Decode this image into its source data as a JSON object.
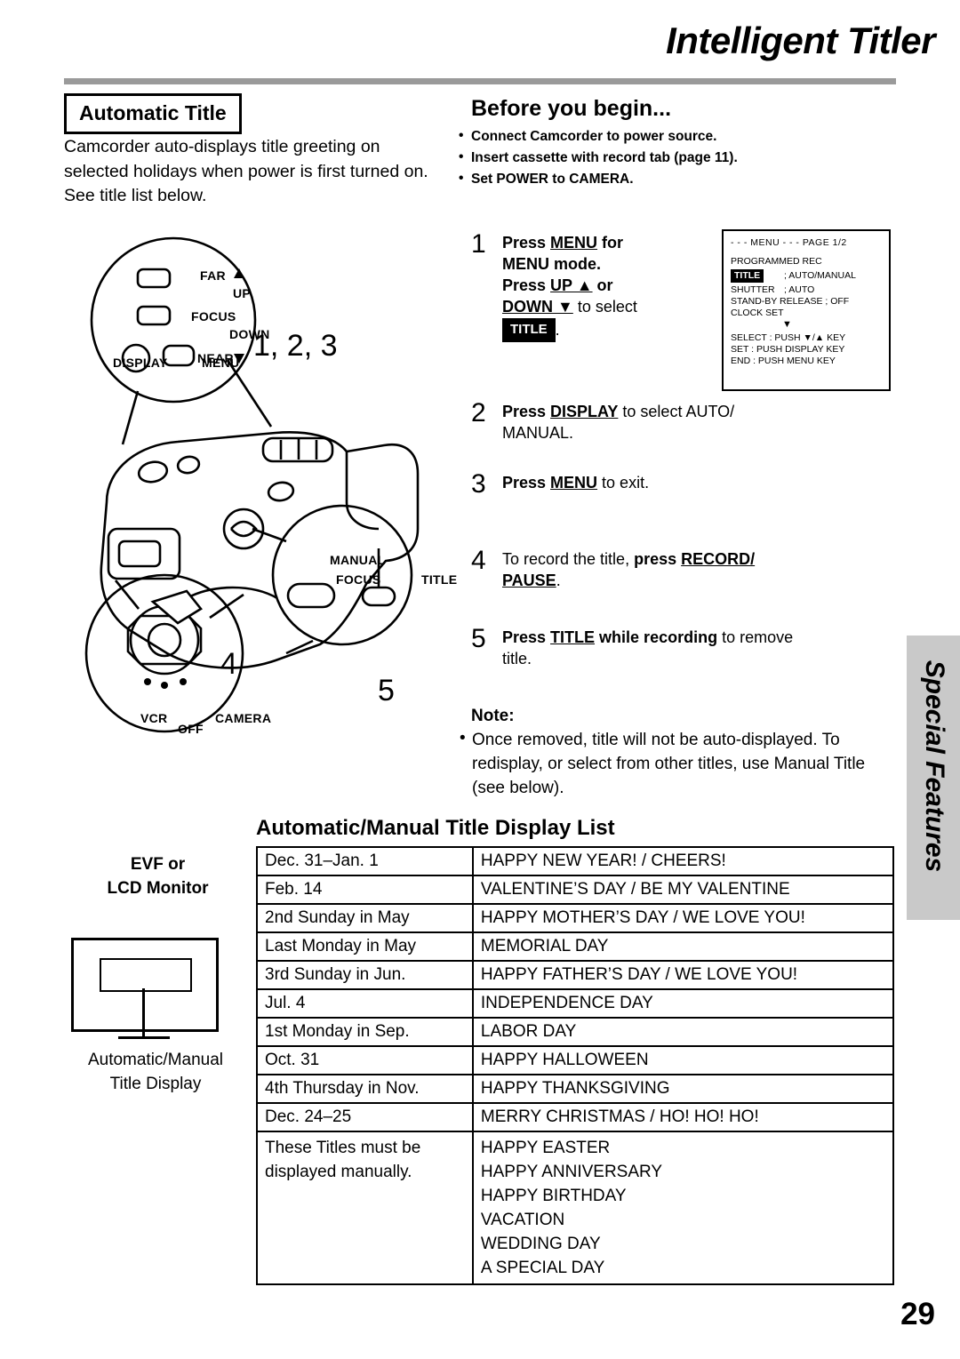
{
  "header": {
    "title": "Intelligent Titler"
  },
  "left": {
    "section_title": "Automatic Title",
    "paragraph": "Camcorder auto-displays title greeting on selected holidays when power is first turned on. See title list below."
  },
  "before": {
    "heading": "Before you begin...",
    "items": [
      "Connect Camcorder to power source.",
      "Insert cassette with record tab (page 11).",
      "Set POWER to CAMERA."
    ]
  },
  "steps": [
    {
      "num": "1",
      "text_parts": [
        "Press ",
        "MENU",
        " for MENU mode. Press ",
        "UP ▲",
        " or ",
        "DOWN ▼",
        " to select ",
        "TITLE",
        "."
      ]
    },
    {
      "num": "2",
      "text": "Press DISPLAY to select AUTO/ MANUAL."
    },
    {
      "num": "3",
      "text": "Press MENU to exit."
    },
    {
      "num": "4",
      "text": "To record the title, press RECORD/ PAUSE."
    },
    {
      "num": "5",
      "text": "Press TITLE while recording to remove title."
    }
  ],
  "step_words": {
    "s1_press": "Press ",
    "s1_menu": "MENU",
    "s1_for": " for",
    "s1_menumode": "MENU mode.",
    "s1_press2": "Press ",
    "s1_up": "UP ▲",
    "s1_or": " or",
    "s1_down": "DOWN ▼",
    "s1_toselect": " to select",
    "s1_title": "TITLE",
    "s1_period": ".",
    "s2_press": "Press ",
    "s2_display": "DISPLAY",
    "s2_rest": " to select AUTO/",
    "s2_manual": "MANUAL.",
    "s3_press": "Press ",
    "s3_menu": "MENU",
    "s3_rest": " to exit.",
    "s4_lead": "To record the title, ",
    "s4_press": "press ",
    "s4_record": "RECORD/",
    "s4_pause": "PAUSE",
    "s4_period": ".",
    "s5_press": "Press ",
    "s5_title": "TITLE",
    "s5_while": " while recording",
    "s5_rest": " to remove",
    "s5_title2": "title."
  },
  "menu_screen": {
    "header": "- - -  MENU  - - -   PAGE 1/2",
    "programmed_rec": "PROGRAMMED REC",
    "title_label": "TITLE",
    "title_value": "; AUTO/MANUAL",
    "shutter_label": "SHUTTER",
    "shutter_value": "; AUTO",
    "standby": "STAND-BY RELEASE ; OFF",
    "clock_set": "CLOCK SET",
    "arrow": "▼",
    "select": "SELECT : PUSH ▼/▲ KEY",
    "set": "SET       : PUSH DISPLAY KEY",
    "end": "END      : PUSH MENU KEY"
  },
  "note": {
    "label": "Note:",
    "body": "Once removed, title will not be auto-displayed. To redisplay, or select from other titles, use Manual Title (see below)."
  },
  "side_tab": {
    "label": "Special Features"
  },
  "list": {
    "heading": "Automatic/Manual Title Display List",
    "rows": [
      {
        "date": "Dec. 31–Jan. 1",
        "title": "HAPPY NEW YEAR! / CHEERS!"
      },
      {
        "date": "Feb. 14",
        "title": "VALENTINE’S DAY / BE MY VALENTINE"
      },
      {
        "date": "2nd Sunday in May",
        "title": "HAPPY MOTHER’S DAY / WE LOVE YOU!"
      },
      {
        "date": "Last Monday in May",
        "title": "MEMORIAL DAY"
      },
      {
        "date": "3rd Sunday in Jun.",
        "title": "HAPPY FATHER’S DAY / WE LOVE YOU!"
      },
      {
        "date": "Jul. 4",
        "title": "INDEPENDENCE DAY"
      },
      {
        "date": "1st Monday in Sep.",
        "title": "LABOR DAY"
      },
      {
        "date": "Oct. 31",
        "title": "HAPPY HALLOWEEN"
      },
      {
        "date": "4th Thursday in Nov.",
        "title": "HAPPY THANKSGIVING"
      },
      {
        "date": "Dec. 24–25",
        "title": "MERRY CHRISTMAS / HO! HO! HO!"
      }
    ],
    "manual_note": "These Titles must be displayed manually.",
    "manual_titles": "HAPPY EASTER\nHAPPY ANNIVERSARY\nHAPPY BIRTHDAY\nVACATION\nWEDDING DAY\nA SPECIAL DAY"
  },
  "evf": {
    "label": "EVF or\nLCD Monitor",
    "caption": "Automatic/Manual\nTitle Display"
  },
  "camera_labels": {
    "far": "FAR",
    "up": "UP",
    "focus": "FOCUS",
    "down": "DOWN",
    "near": "NEAR",
    "display": "DISPLAY",
    "menu": "MENU",
    "manual": "MANUAL",
    "manual_focus": "FOCUS",
    "title": "TITLE",
    "vcr": "VCR",
    "off": "OFF",
    "camera": "CAMERA",
    "callout_123": "1, 2, 3",
    "callout_4": "4",
    "callout_5": "5"
  },
  "page_number": "29"
}
